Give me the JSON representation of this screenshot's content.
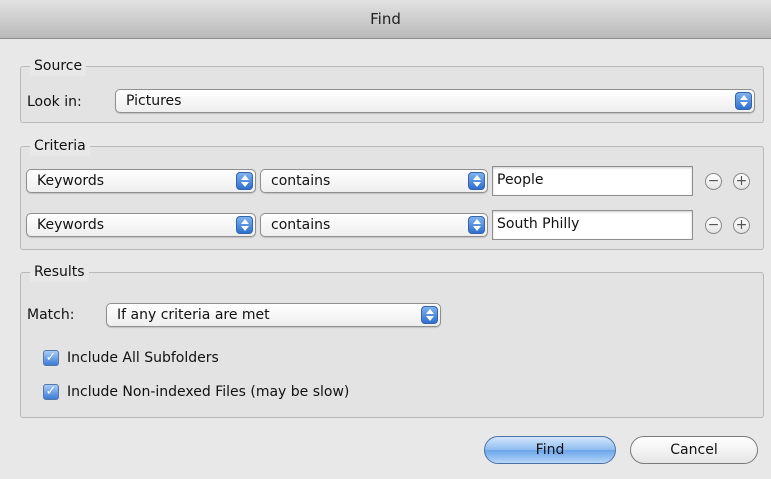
{
  "window": {
    "title": "Find"
  },
  "source": {
    "legend": "Source",
    "look_in_label": "Look in:",
    "look_in_value": "Pictures"
  },
  "criteria": {
    "legend": "Criteria",
    "rows": [
      {
        "attribute": "Keywords",
        "operator": "contains",
        "value": "People"
      },
      {
        "attribute": "Keywords",
        "operator": "contains",
        "value": "South Philly"
      }
    ],
    "remove_symbol": "−",
    "add_symbol": "+"
  },
  "results": {
    "legend": "Results",
    "match_label": "Match:",
    "match_value": "If any criteria are met",
    "options": [
      {
        "label": "Include All Subfolders",
        "checked": true
      },
      {
        "label": "Include Non-indexed Files (may be slow)",
        "checked": true
      }
    ]
  },
  "buttons": {
    "find": "Find",
    "cancel": "Cancel"
  },
  "colors": {
    "accent": "#3c7bd6",
    "default_button": "#8ebcf1"
  }
}
